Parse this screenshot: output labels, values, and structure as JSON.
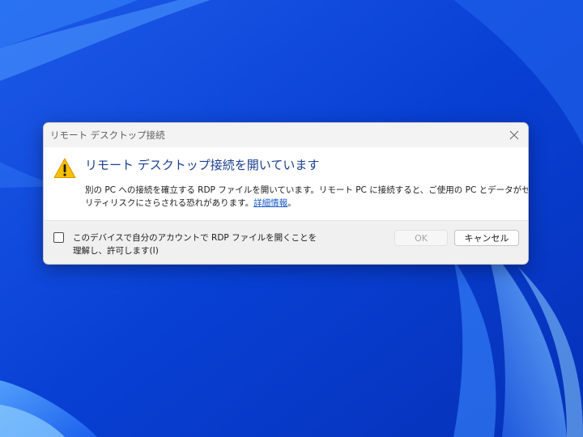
{
  "window": {
    "title": "リモート デスクトップ接続",
    "close_icon": "close-icon"
  },
  "dialog": {
    "icon": "warning-icon",
    "heading": "リモート デスクトップ接続を開いています",
    "message_line1": "別の PC への接続を確立する RDP ファイルを開いています。リモート PC に接続すると、ご使用の PC とデータがセキュ",
    "message_line2_prefix": "リティリスクにさらされる恐れがあります。",
    "details_link": "詳細情報",
    "message_line2_suffix": "。"
  },
  "footer": {
    "checkbox_checked": false,
    "checkbox_label_line1": "このデバイスで自分のアカウントで RDP ファイルを開くことを",
    "checkbox_label_line2": "理解し、許可します(I)",
    "ok_label": "OK",
    "cancel_label": "キャンセル"
  },
  "colors": {
    "desktop_background": "#0a3fd6",
    "heading_text": "#1a3f8e",
    "link": "#1a5bc8",
    "warning_fill": "#f6c000"
  }
}
